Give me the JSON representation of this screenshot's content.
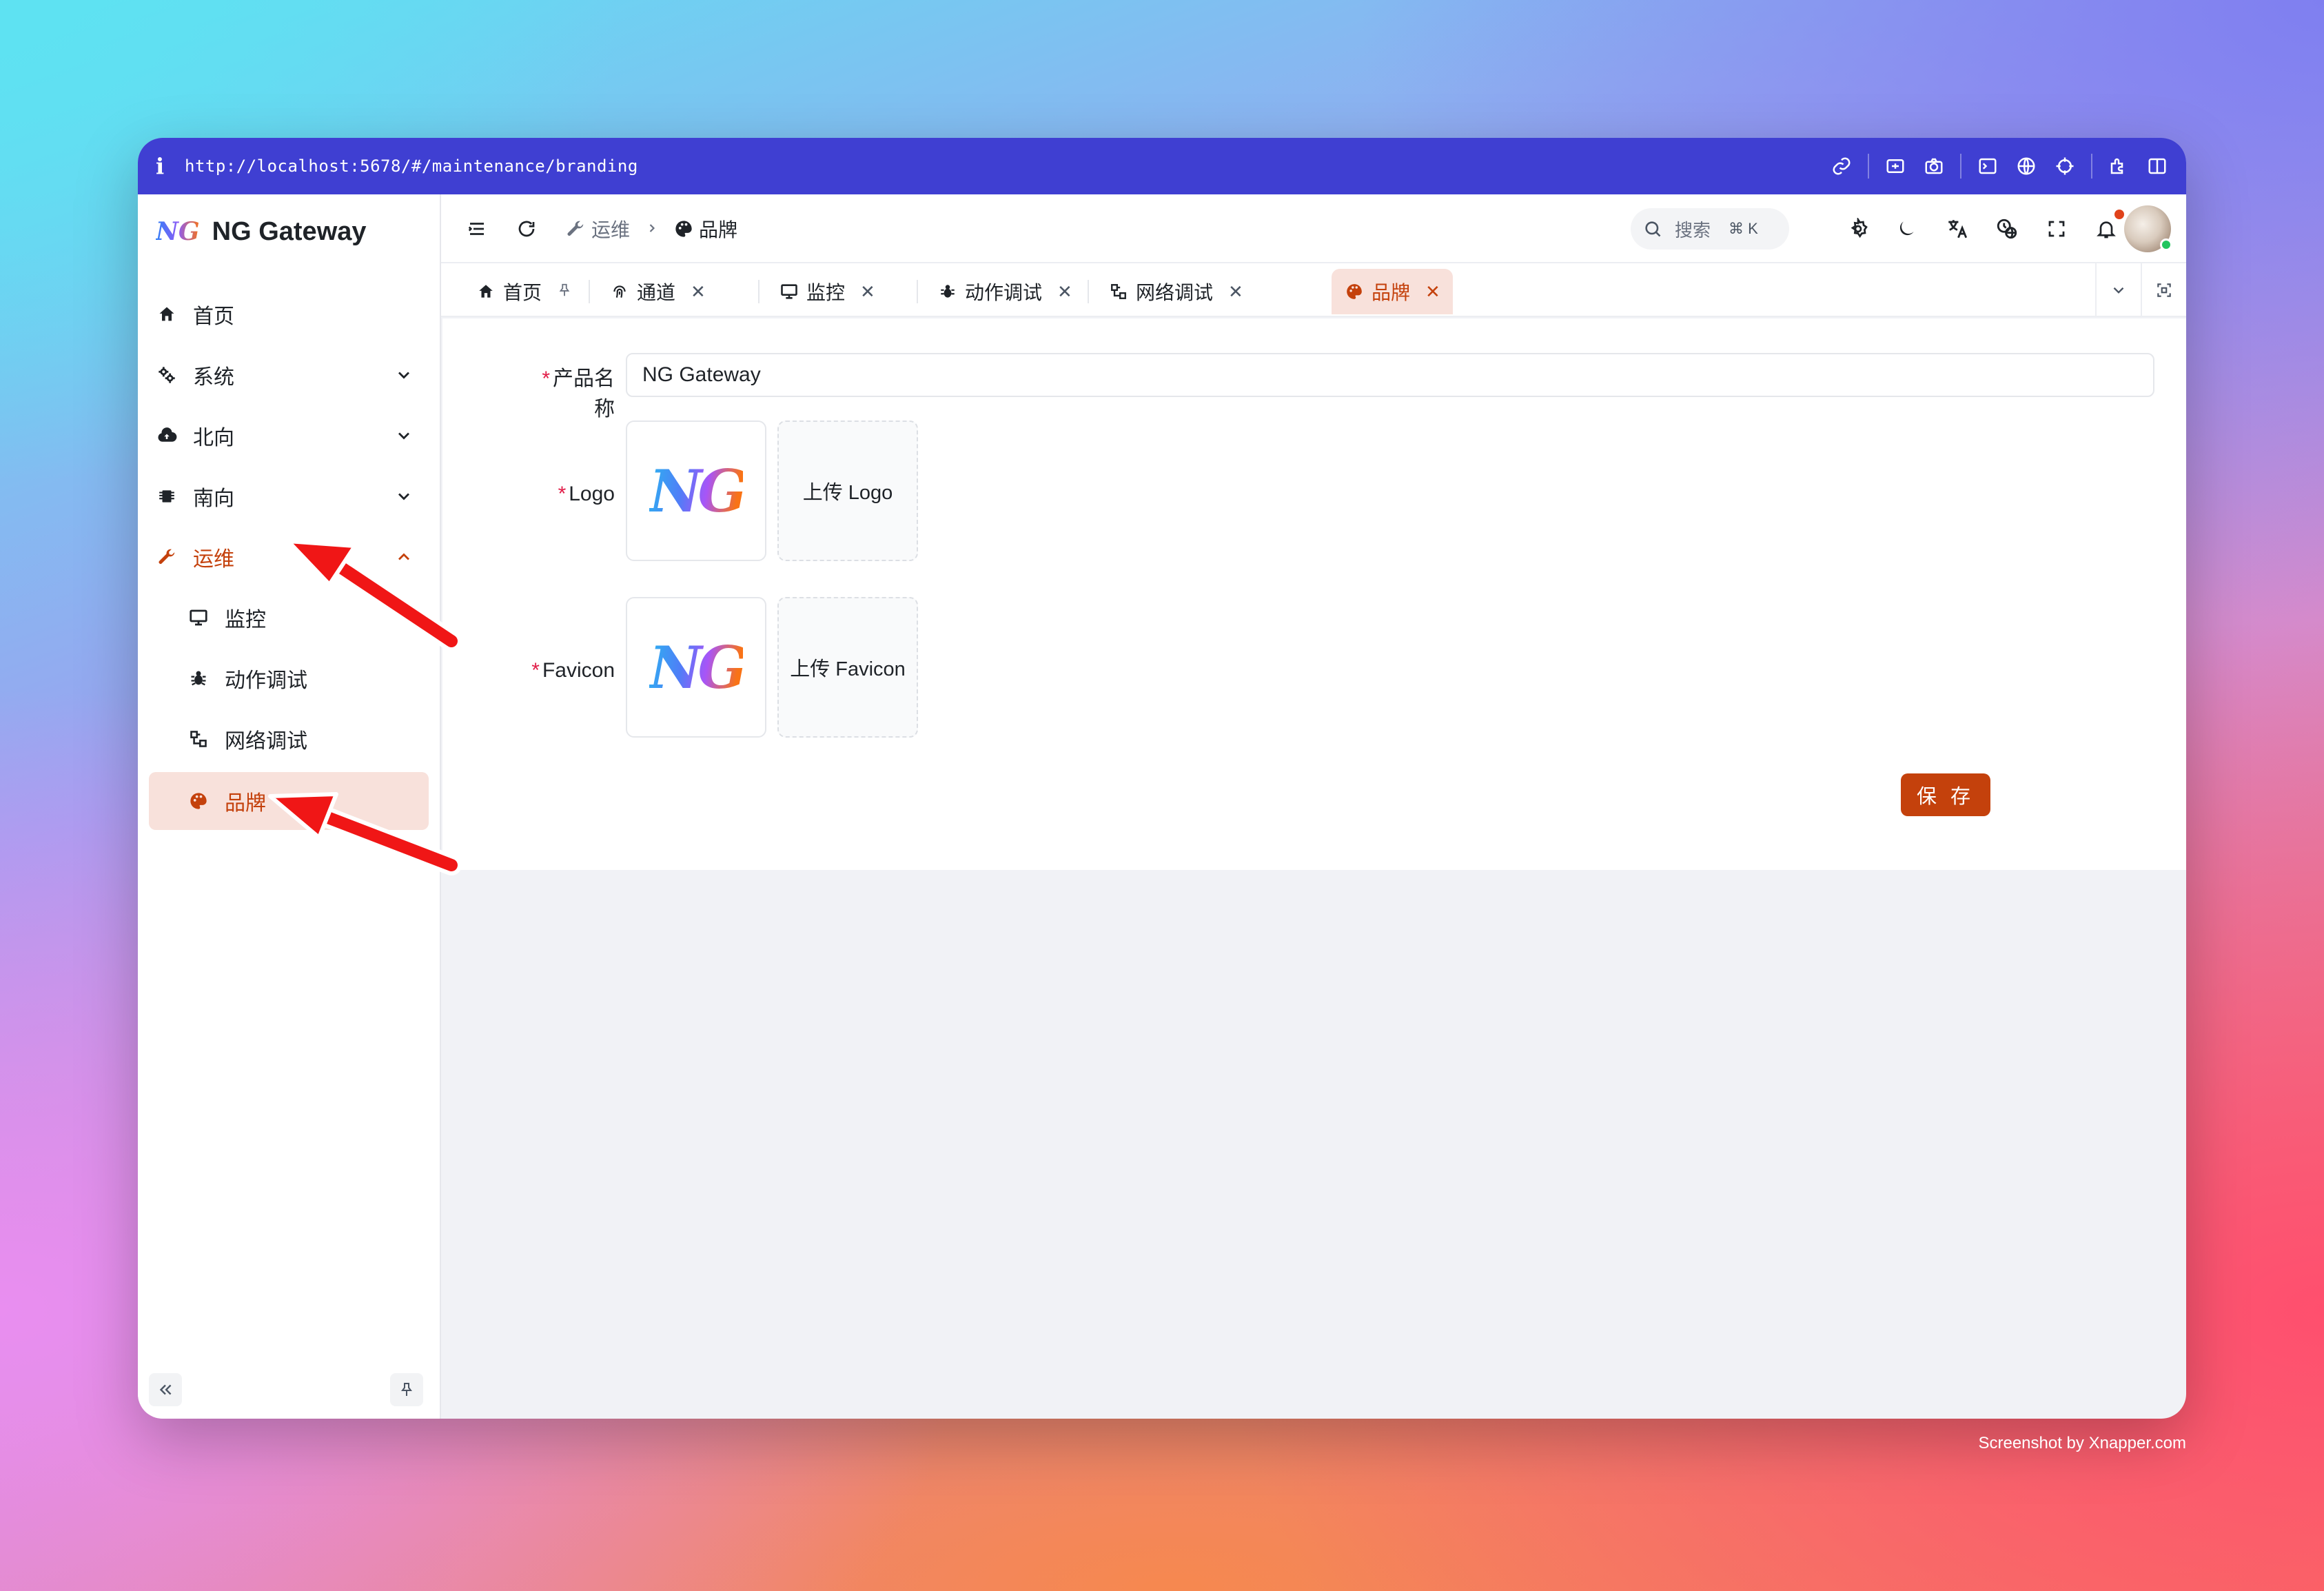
{
  "browser": {
    "info_glyph": "i",
    "url": "http://localhost:5678/#/maintenance/branding"
  },
  "sidebar": {
    "logo_text": "NG",
    "app_name": "NG Gateway",
    "items": [
      {
        "label": "首页",
        "icon": "home-icon"
      },
      {
        "label": "系统",
        "icon": "gears-icon"
      },
      {
        "label": "北向",
        "icon": "cloud-upload-icon"
      },
      {
        "label": "南向",
        "icon": "chip-icon"
      },
      {
        "label": "运维",
        "icon": "wrench-icon"
      },
      {
        "label": "监控",
        "icon": "monitor-icon"
      },
      {
        "label": "动作调试",
        "icon": "bug-icon"
      },
      {
        "label": "网络调试",
        "icon": "network-icon"
      },
      {
        "label": "品牌",
        "icon": "palette-icon"
      }
    ]
  },
  "header": {
    "breadcrumb_parent": "运维",
    "breadcrumb_current": "品牌",
    "search_placeholder": "搜索",
    "search_shortcut": "⌘ K"
  },
  "tabs": [
    {
      "label": "首页"
    },
    {
      "label": "通道"
    },
    {
      "label": "监控"
    },
    {
      "label": "动作调试"
    },
    {
      "label": "网络调试"
    },
    {
      "label": "品牌"
    }
  ],
  "form": {
    "required_mark": "*",
    "product_name_label": "产品名称",
    "product_name_value": "NG Gateway",
    "logo_label": "Logo",
    "logo_upload": "上传 Logo",
    "favicon_label": "Favicon",
    "favicon_upload": "上传 Favicon",
    "logo_preview_text": "NG",
    "save_label": "保 存"
  },
  "colors": {
    "accent": "#c4410c",
    "url_bar": "#3f3fd2",
    "active_bg": "#f8e1db"
  },
  "watermark": "Screenshot by Xnapper.com"
}
